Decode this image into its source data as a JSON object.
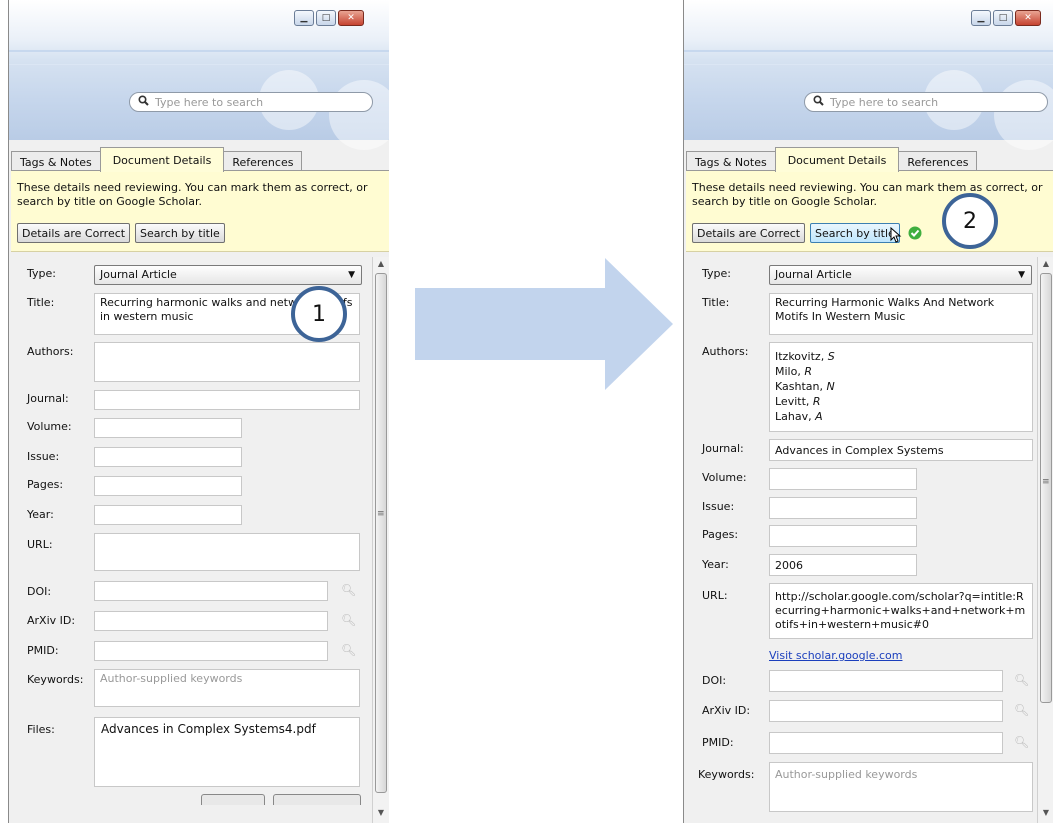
{
  "search": {
    "placeholder": "Type here to search"
  },
  "tabs": [
    "Tags & Notes",
    "Document Details",
    "References"
  ],
  "review": {
    "text": "These details need reviewing. You can mark them as correct, or search by title on Google Scholar.",
    "correct_btn": "Details are Correct",
    "search_btn": "Search by title"
  },
  "labels": {
    "type": "Type:",
    "title": "Title:",
    "authors": "Authors:",
    "journal": "Journal:",
    "volume": "Volume:",
    "issue": "Issue:",
    "pages": "Pages:",
    "year": "Year:",
    "url": "URL:",
    "doi": "DOI:",
    "arxiv": "ArXiv ID:",
    "pmid": "PMID:",
    "keywords": "Keywords:",
    "files": "Files:"
  },
  "left": {
    "step": "1",
    "type": "Journal Article",
    "title": "Recurring harmonic walks and network motifs in western music",
    "keywords_placeholder": "Author-supplied keywords",
    "file": "Advances in Complex Systems4.pdf"
  },
  "right": {
    "step": "2",
    "type": "Journal Article",
    "title": "Recurring Harmonic Walks And Network Motifs In Western Music",
    "authors": [
      {
        "last": "Itzkovitz",
        "first": "S"
      },
      {
        "last": "Milo",
        "first": "R"
      },
      {
        "last": "Kashtan",
        "first": "N"
      },
      {
        "last": "Levitt",
        "first": "R"
      },
      {
        "last": "Lahav",
        "first": "A"
      }
    ],
    "journal": "Advances in Complex Systems",
    "year": "2006",
    "url": "http://scholar.google.com/scholar?q=intitle:Recurring+harmonic+walks+and+network+motifs+in+western+music#0",
    "visit_link": "Visit scholar.google.com",
    "keywords_placeholder": "Author-supplied keywords"
  }
}
